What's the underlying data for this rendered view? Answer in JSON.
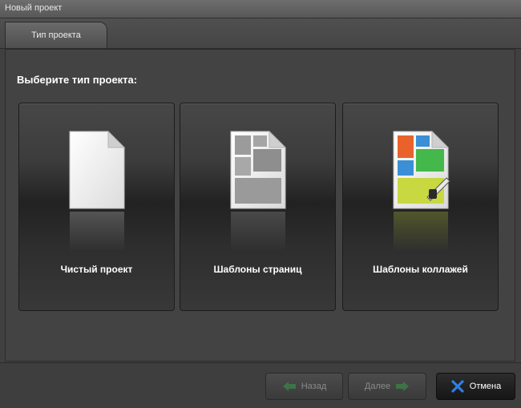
{
  "window": {
    "title": "Новый проект"
  },
  "tabs": [
    {
      "label": "Тип проекта",
      "active": true
    }
  ],
  "main": {
    "prompt": "Выберите тип проекта:",
    "options": [
      {
        "label": "Чистый проект",
        "icon": "blank-page-icon"
      },
      {
        "label": "Шаблоны страниц",
        "icon": "page-template-icon"
      },
      {
        "label": "Шаблоны коллажей",
        "icon": "collage-template-icon"
      }
    ]
  },
  "footer": {
    "back_label": "Назад",
    "back_enabled": false,
    "next_label": "Далее",
    "next_enabled": false,
    "cancel_label": "Отмена"
  },
  "colors": {
    "collage_orange": "#e9622c",
    "collage_green": "#44b84a",
    "collage_blue": "#3b8fd6",
    "collage_yellow": "#c8d840",
    "arrow_green": "#3a9a4a",
    "cancel_blue": "#2f7fe0"
  }
}
